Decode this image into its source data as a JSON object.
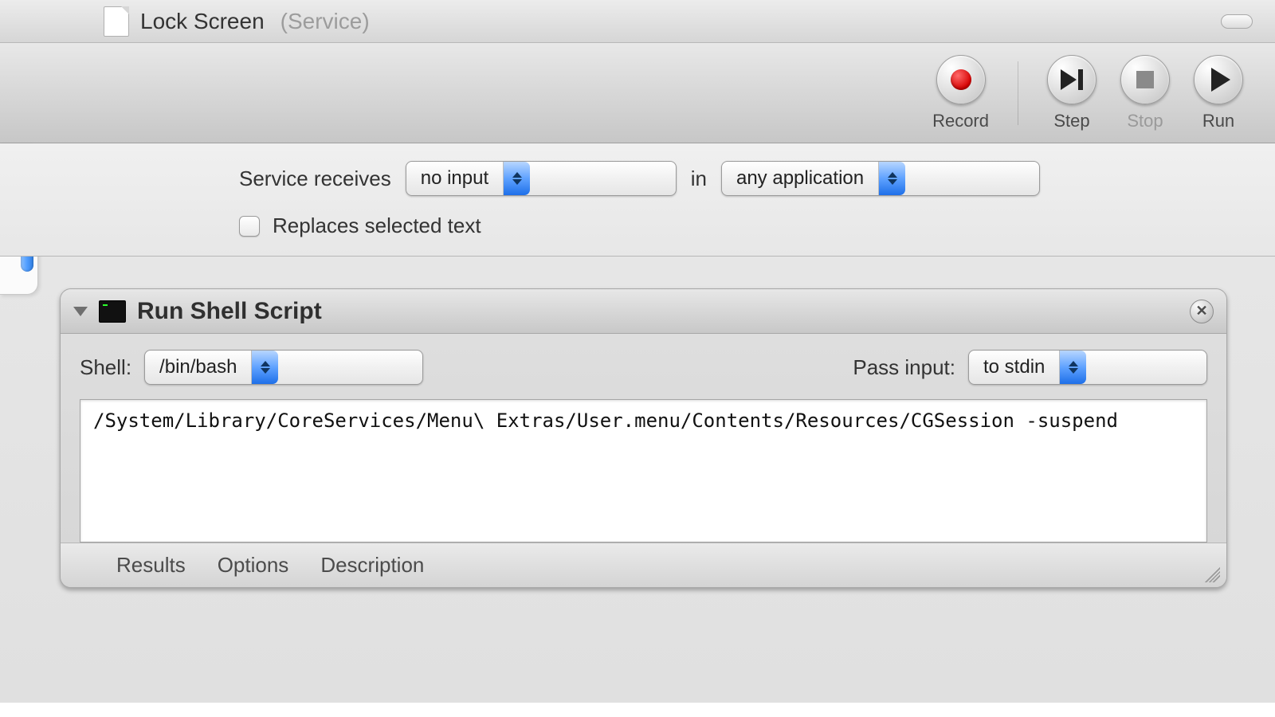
{
  "titlebar": {
    "doc_name": "Lock Screen",
    "doc_kind": "(Service)"
  },
  "toolbar": {
    "record": "Record",
    "step": "Step",
    "stop": "Stop",
    "run": "Run"
  },
  "config": {
    "receives_label": "Service receives",
    "input_select": "no input",
    "in_label": "in",
    "app_select": "any application",
    "replaces_label": "Replaces selected text",
    "replaces_checked": false
  },
  "action": {
    "title": "Run Shell Script",
    "shell_label": "Shell:",
    "shell_value": "/bin/bash",
    "pass_label": "Pass input:",
    "pass_value": "to stdin",
    "script": "/System/Library/CoreServices/Menu\\ Extras/User.menu/Contents/Resources/CGSession -suspend",
    "tabs": {
      "results": "Results",
      "options": "Options",
      "description": "Description"
    }
  }
}
